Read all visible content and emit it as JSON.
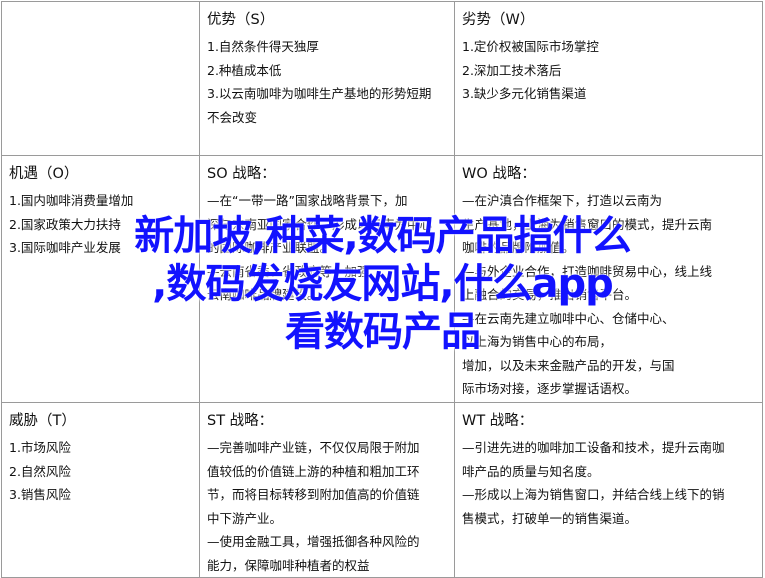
{
  "swot": {
    "strengths": {
      "title": "优势（S）",
      "items": [
        "1.自然条件得天独厚",
        "2.种植成本低",
        "3.以云南咖啡为咖啡生产基地的形势短期",
        "不会改变"
      ]
    },
    "weaknesses": {
      "title": "劣势（W）",
      "items": [
        "1.定价权被国际市场掌控",
        "2.深加工技术落后",
        "3.缺少多元化销售渠道"
      ]
    },
    "opportunities": {
      "title": "机遇（O）",
      "items": [
        "1.国内咖啡消费量增加",
        "2.国家政策大力扶持",
        "3.国际咖啡产业发展"
      ]
    },
    "so": {
      "title": "SO 战略：",
      "lines": [
        "—在“一带一路”国家战略背景下，加",
        "深与东南亚国家合作，形成以云南为中心",
        "的国际咖啡产业联盟。",
        "—云南省委、省政府等，加强",
        "云南咖啡品牌建设。"
      ]
    },
    "wo": {
      "title": "WO 战略：",
      "lines": [
        "—在沪滇合作框架下，打造以云南为",
        "生产基地，上海为销售窗口的模式，提升云南",
        "咖啡的品牌附加值。",
        "—与外企业合作，打造咖啡贸易中心，线上线",
        "上融合的交易，推出销售平台。",
        "—在云南先建立咖啡中心、仓储中心、",
        "以上海为销售中心的布局，",
        "增加，以及未来金融产品的开发，与国",
        "际市场对接，逐步掌握话语权。"
      ]
    },
    "threats": {
      "title": "威胁（T）",
      "items": [
        "1.市场风险",
        "2.自然风险",
        "3.销售风险"
      ]
    },
    "st": {
      "title": "ST 战略：",
      "lines": [
        "—完善咖啡产业链，不仅仅局限于附加",
        "值较低的价值链上游的种植和粗加工环",
        "节，而将目标转移到附加值高的价值链",
        "中下游产业。",
        "—使用金融工具，增强抵御各种风险的",
        "能力，保障咖啡种植者的权益"
      ]
    },
    "wt": {
      "title": "WT 战略：",
      "lines": [
        "—引进先进的咖啡加工设备和技术，提升云南咖",
        "啡产品的质量与知名度。",
        "—形成以上海为销售窗口，并结合线上线下的销",
        "售模式，打破单一的销售渠道。"
      ]
    }
  },
  "overlay": {
    "line1": "新加坡,种菜,数码产品指什么",
    "line2": ",数码发烧友网站,什么app",
    "line3": "看数码产品"
  }
}
